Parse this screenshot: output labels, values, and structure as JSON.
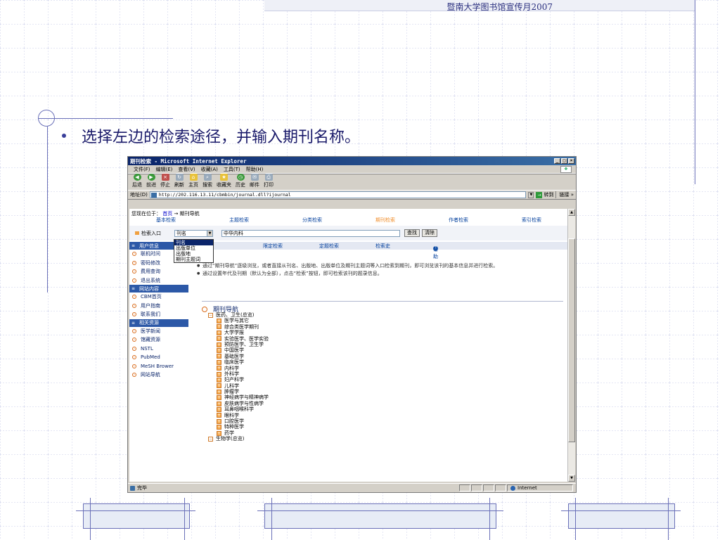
{
  "slide": {
    "header_text": "暨南大学图书馆宣传月2007",
    "bullet_text": "选择左边的检索途径，并输入期刊名称。"
  },
  "browser": {
    "title": "期刊检索 - Microsoft Internet Explorer",
    "menu": [
      "文件(F)",
      "编辑(E)",
      "查看(V)",
      "收藏(A)",
      "工具(T)",
      "帮助(H)"
    ],
    "toolbar": [
      "后退",
      "前进",
      "停止",
      "刷新",
      "主页",
      "搜索",
      "收藏夹",
      "历史",
      "邮件",
      "打印"
    ],
    "address_label": "地址(D)",
    "address": "http://202.116.13.11/cbmbin/journal.dll?ijournal",
    "go_label": "转到",
    "links_label": "链接",
    "status_text": "完毕",
    "zone_text": "Internet"
  },
  "page": {
    "crumb_prefix": "您现在位于：",
    "crumb_home": "首页",
    "crumb_sep": "→",
    "crumb_current": "期刊导航",
    "top_nav": [
      "基本检索",
      "主题检索",
      "分类检索",
      "期刊检索",
      "作者检索",
      "索引检索"
    ],
    "active_nav": "期刊检索",
    "search_label": "检索入口",
    "select_value": "刊名",
    "dropdown_options": [
      "刊名",
      "出版单位",
      "出版地",
      "期刊主题词"
    ],
    "query_value": "中华内科",
    "search_button": "查找",
    "clear_button": "清除",
    "sub_nav": [
      "限定检索",
      "定题检索",
      "检索史",
      "帮助"
    ],
    "tips": [
      "通过“期刊导航”逐级浏览，或者直接从刊名、出版地、出版单位及期刊主题词等入口检索到期刊，即可浏览该刊的基本信息并进行检索。",
      "通过设置年代及刊期（默认为全部），点击“检索”按钮，即可检索该刊的题录信息。"
    ],
    "journal_title": "期刊导航",
    "sidebar": [
      {
        "head": "用户信息",
        "items": [
          "联机时间",
          "密码修改",
          "费用查询",
          "退出系统"
        ]
      },
      {
        "head": "网站内容",
        "items": [
          "CBM首页",
          "用户指南",
          "联系我们"
        ]
      },
      {
        "head": "相关资源",
        "items": [
          "医学新闻",
          "馆藏资源",
          "NSTL",
          "PubMed",
          "MeSH Brower",
          "网站导航"
        ]
      }
    ],
    "tree_root": "医药、卫生(总览)",
    "tree_children": [
      "医学与其它",
      "综合类医学期刊",
      "大学学报",
      "实验医学、医学实验",
      "预防医学、卫生学",
      "中国医学",
      "基础医学",
      "临床医学",
      "内科学",
      "外科学",
      "妇产科学",
      "儿科学",
      "肿瘤学",
      "神经病学与精神病学",
      "皮肤病学与性病学",
      "耳鼻咽喉科学",
      "眼科学",
      "口腔医学",
      "特种医学",
      "药学"
    ],
    "tree_root2": "生物学(总览)"
  }
}
